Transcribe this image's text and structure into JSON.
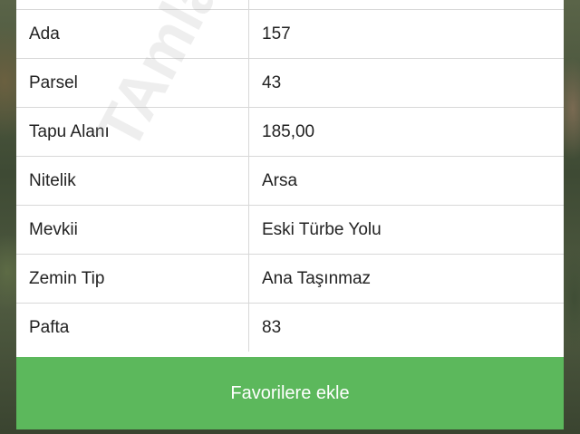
{
  "rows": [
    {
      "label": "Ada",
      "value": "157"
    },
    {
      "label": "Parsel",
      "value": "43"
    },
    {
      "label": "Tapu Alanı",
      "value": "185,00"
    },
    {
      "label": "Nitelik",
      "value": "Arsa"
    },
    {
      "label": "Mevkii",
      "value": "Eski Türbe Yolu"
    },
    {
      "label": "Zemin Tip",
      "value": "Ana Taşınmaz"
    },
    {
      "label": "Pafta",
      "value": "83"
    }
  ],
  "favorite_button": {
    "label": "Favorilere ekle"
  },
  "watermark": {
    "text": "TAmlaklet.com"
  },
  "colors": {
    "button_green": "#5cb85c",
    "border": "#d8d8d8"
  }
}
